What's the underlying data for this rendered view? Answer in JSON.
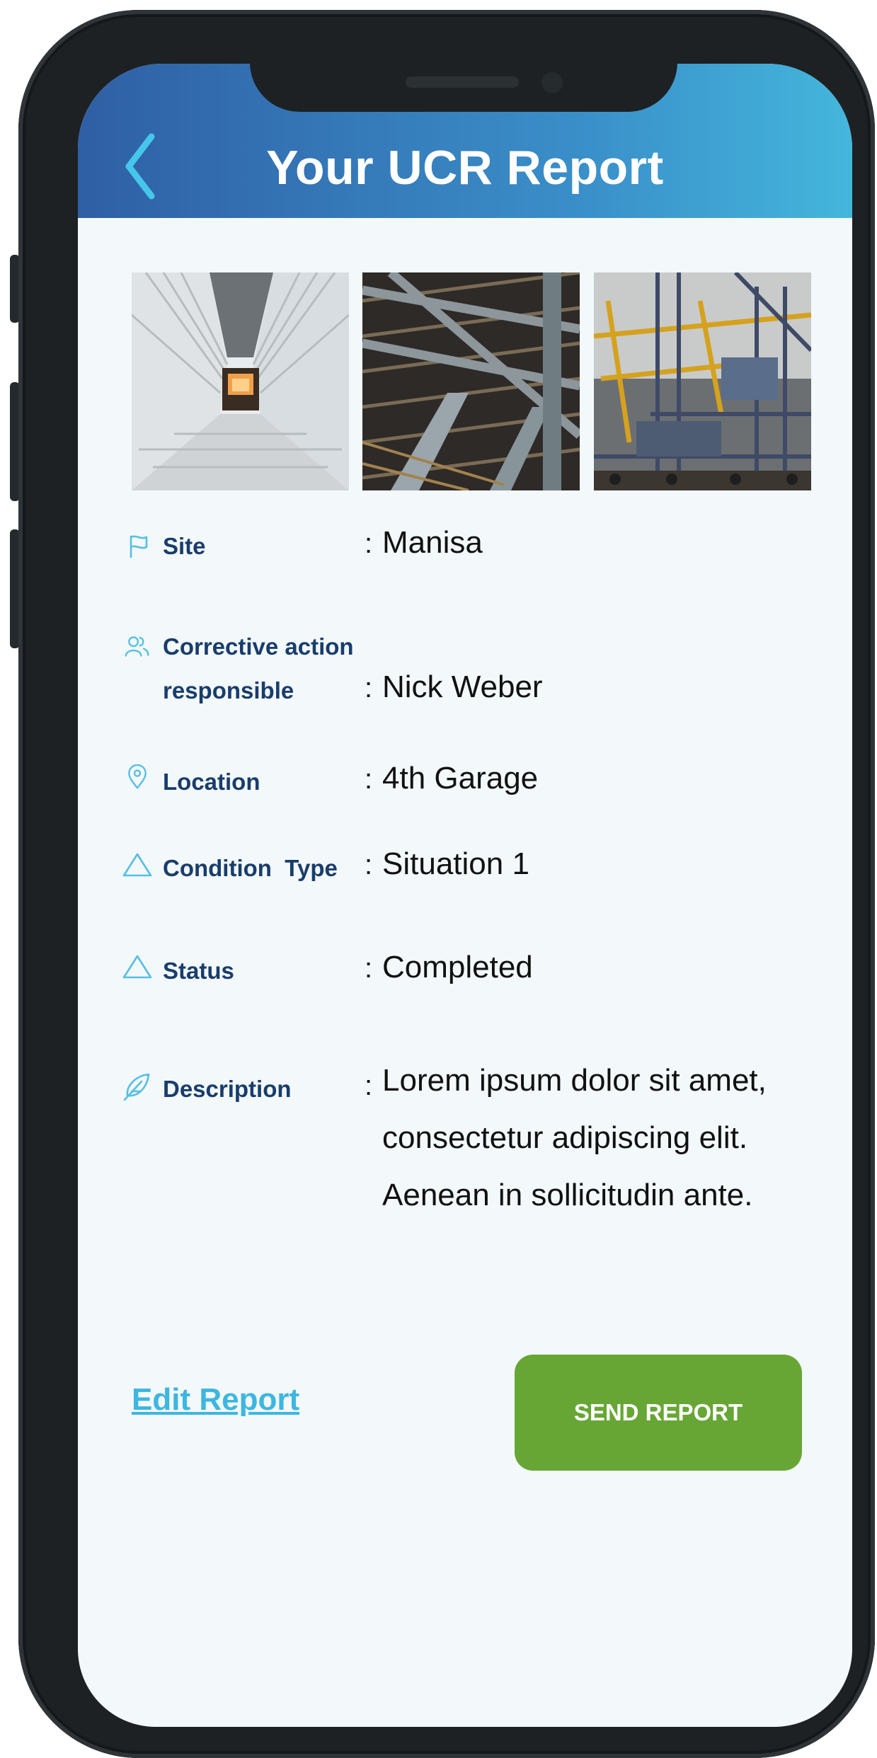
{
  "header": {
    "title": "Your UCR Report",
    "back_icon": "chevron-left-icon"
  },
  "photos": [
    {
      "name": "corridor-photo"
    },
    {
      "name": "steel-structure-photo"
    },
    {
      "name": "crane-photo"
    }
  ],
  "details": [
    {
      "icon": "flag-icon",
      "label": "Site",
      "value": "Manisa"
    },
    {
      "icon": "users-icon",
      "label_line1": "Corrective action",
      "label_line2": "responsible",
      "value": "Nick Weber"
    },
    {
      "icon": "location-pin-icon",
      "label": "Location",
      "value": "4th Garage"
    },
    {
      "icon": "triangle-icon",
      "label": "Condition  Type",
      "value": "Situation 1"
    },
    {
      "icon": "triangle-icon",
      "label": "Status",
      "value": "Completed"
    },
    {
      "icon": "feather-icon",
      "label": "Description",
      "value_lines": [
        "Lorem ipsum dolor sit amet,",
        "consectetur adipiscing elit.",
        "Aenean in sollicitudin ante."
      ]
    }
  ],
  "separator": ":",
  "actions": {
    "edit_label": "Edit Report",
    "send_label": "SEND REPORT"
  },
  "colors": {
    "header_gradient_start": "#2f5fa5",
    "header_gradient_end": "#44b6dc",
    "label": "#193d6b",
    "icon": "#56bfe2",
    "link": "#3db6e0",
    "primary_button": "#67a635",
    "screen_bg": "#f3f8fb"
  }
}
